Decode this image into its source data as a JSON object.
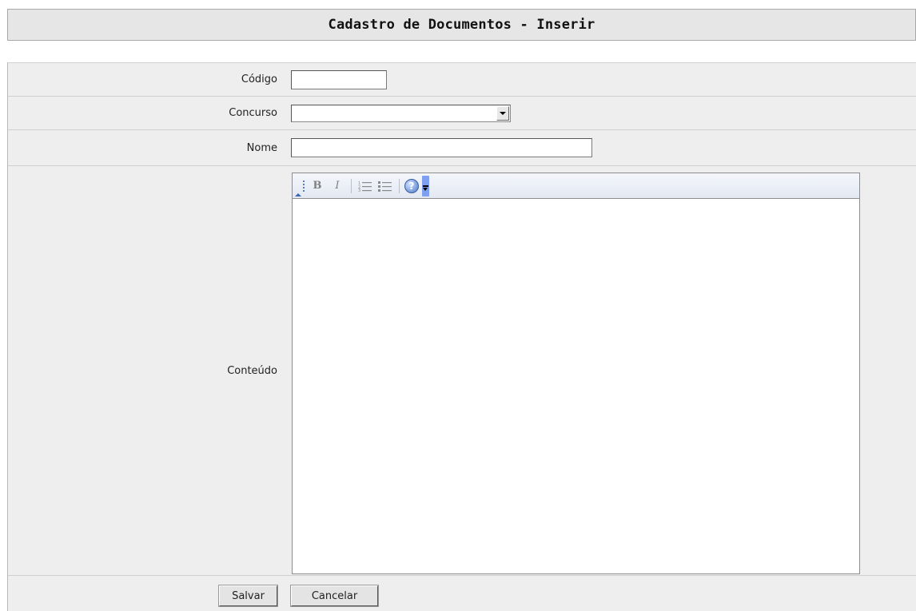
{
  "header": {
    "title": "Cadastro de Documentos - Inserir"
  },
  "form": {
    "codigo": {
      "label": "Código",
      "value": ""
    },
    "concurso": {
      "label": "Concurso",
      "selected": ""
    },
    "nome": {
      "label": "Nome",
      "value": ""
    },
    "conteudo": {
      "label": "Conteúdo",
      "value": "",
      "toolbar": {
        "bold_label": "B",
        "italic_label": "I",
        "help_label": "?",
        "icons": [
          "collapse-toolbar-icon",
          "bold-icon",
          "italic-icon",
          "ordered-list-icon",
          "unordered-list-icon",
          "help-icon",
          "toolbar-options-icon"
        ]
      }
    }
  },
  "actions": {
    "save_label": "Salvar",
    "cancel_label": "Cancelar"
  },
  "colors": {
    "row_background": "#eeeeee",
    "header_background": "#e6e6e6",
    "toolbar_accent": "#4b78c9"
  }
}
